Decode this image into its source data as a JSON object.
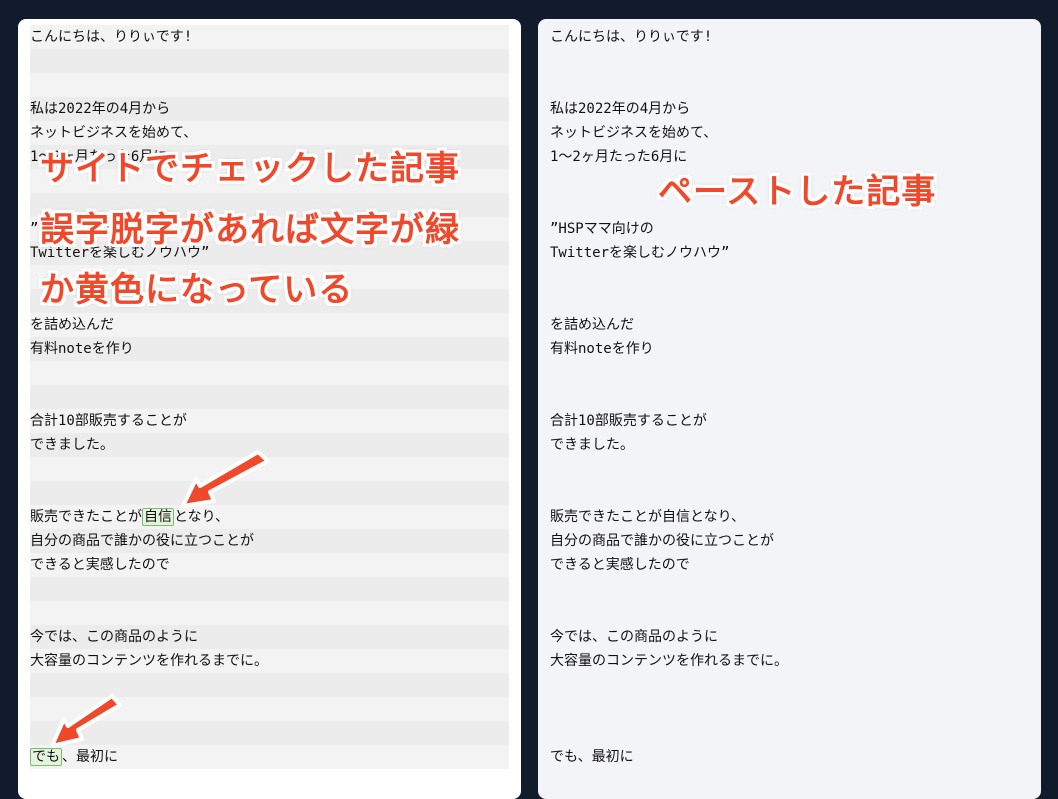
{
  "left_panel": {
    "lines": [
      "こんにちは、りりぃです!",
      "",
      "",
      "私は2022年の4月から",
      "ネットビジネスを始めて、",
      "1〜2ヶ月たった6月に",
      "",
      "",
      "”HSPママ向けの",
      "Twitterを楽しむノウハウ”",
      "",
      "",
      "を詰め込んだ",
      "有料noteを作り",
      "",
      "",
      "合計10部販売することが",
      "できました。",
      "",
      "",
      "",
      "自分の商品で誰かの役に立つことが",
      "できると実感したので",
      "",
      "",
      "今では、この商品のように",
      "大容量のコンテンツを作れるまでに。",
      "",
      "",
      "",
      ""
    ],
    "hl_line1": {
      "before": "販売できたことが",
      "highlight": "自信",
      "after": "となり、"
    },
    "hl_line2": {
      "before": "",
      "highlight": "でも",
      "after": "、最初に"
    }
  },
  "right_panel": {
    "lines": [
      "こんにちは、りりぃです!",
      "",
      "",
      "私は2022年の4月から",
      "ネットビジネスを始めて、",
      "1〜2ヶ月たった6月に",
      "",
      "",
      "”HSPママ向けの",
      "Twitterを楽しむノウハウ”",
      "",
      "",
      "を詰め込んだ",
      "有料noteを作り",
      "",
      "",
      "合計10部販売することが",
      "できました。",
      "",
      "",
      "販売できたことが自信となり、",
      "自分の商品で誰かの役に立つことが",
      "できると実感したので",
      "",
      "",
      "今では、この商品のように",
      "大容量のコンテンツを作れるまでに。",
      "",
      "",
      "",
      "でも、最初に"
    ]
  },
  "annotations": {
    "left_title": "サイトでチェックした記事",
    "left_note_1": "誤字脱字があれば文字が緑",
    "left_note_2": "か黄色になっている",
    "right_title": "ペーストした記事"
  },
  "colors": {
    "background": "#111b2c",
    "annotation_text": "#f0482a",
    "highlight_bg": "#e5f3df",
    "highlight_border": "#7dbb6f"
  }
}
